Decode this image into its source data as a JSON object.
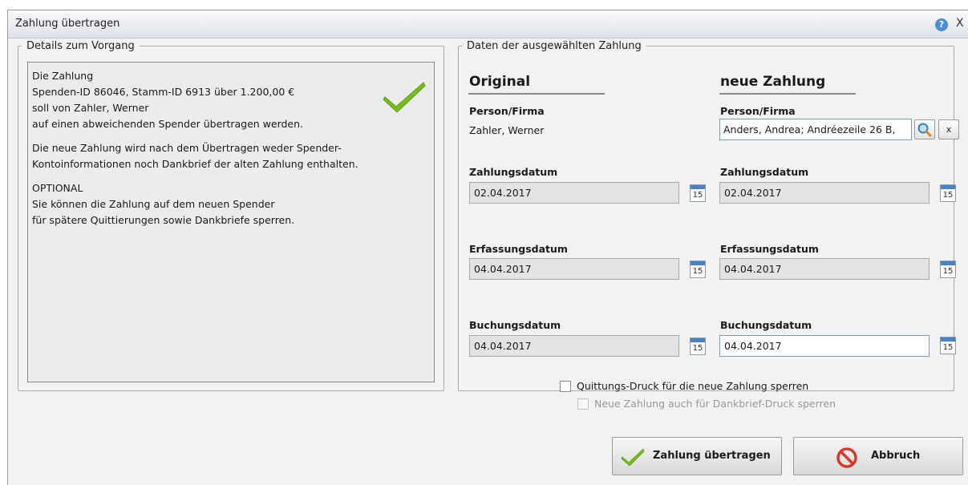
{
  "window": {
    "title": "Zahlung übertragen",
    "help_glyph": "?",
    "close_glyph": "X"
  },
  "details": {
    "legend": "Details zum Vorgang",
    "lines": [
      "Die Zahlung",
      "Spenden-ID 86046, Stamm-ID 6913 über 1.200,00 €",
      "soll von Zahler, Werner",
      "auf einen abweichenden Spender übertragen werden."
    ],
    "lines2": [
      "Die neue Zahlung wird nach dem Übertragen weder Spender-",
      "Kontoinformationen noch Dankbrief der alten Zahlung enthalten."
    ],
    "lines3": [
      "OPTIONAL",
      "Sie können die Zahlung auf dem neuen Spender",
      "für spätere Quittierungen sowie Dankbriefe sperren."
    ]
  },
  "payment": {
    "legend": "Daten der ausgewählten Zahlung",
    "original": {
      "heading": "Original",
      "person_label": "Person/Firma",
      "person_value": "Zahler, Werner",
      "zahlungsdatum_label": "Zahlungsdatum",
      "zahlungsdatum": "02.04.2017",
      "erfassungsdatum_label": "Erfassungsdatum",
      "erfassungsdatum": "04.04.2017",
      "buchungsdatum_label": "Buchungsdatum",
      "buchungsdatum": "04.04.2017"
    },
    "new": {
      "heading": "neue Zahlung",
      "person_label": "Person/Firma",
      "person_value": "Anders, Andrea; Andréezeile 26 B,",
      "clear_label": "x",
      "zahlungsdatum_label": "Zahlungsdatum",
      "zahlungsdatum": "02.04.2017",
      "erfassungsdatum_label": "Erfassungsdatum",
      "erfassungsdatum": "04.04.2017",
      "buchungsdatum_label": "Buchungsdatum",
      "buchungsdatum": "04.04.2017"
    },
    "calendar_day": "15",
    "checkbox_quittung": "Quittungs-Druck für die neue Zahlung sperren",
    "checkbox_dankbrief": "Neue Zahlung auch für Dankbrief-Druck sperren"
  },
  "buttons": {
    "transfer": "Zahlung übertragen",
    "cancel": "Abbruch"
  },
  "colors": {
    "accent_check": "#7cbd1e",
    "cancel_red": "#d9382e",
    "help_blue": "#4a8fd8"
  }
}
